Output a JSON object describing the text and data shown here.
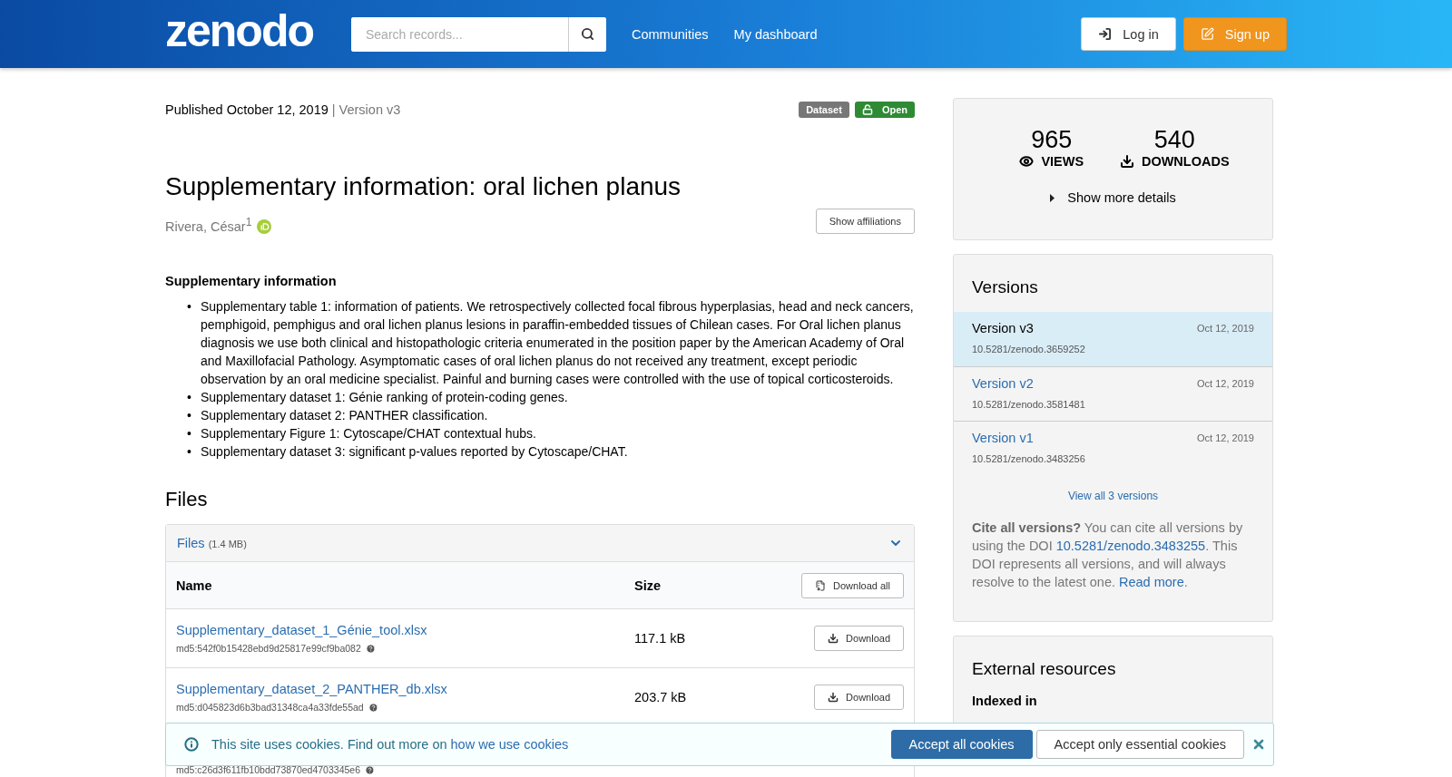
{
  "header": {
    "logo": "zenodo",
    "search": {
      "placeholder": "Search records..."
    },
    "nav": [
      {
        "label": "Communities"
      },
      {
        "label": "My dashboard"
      }
    ],
    "login": "Log in",
    "signup": "Sign up"
  },
  "record": {
    "published": "Published October 12, 2019",
    "version": "| Version v3",
    "badges": [
      {
        "label": "Dataset",
        "kind": "type"
      },
      {
        "label": "Open",
        "kind": "access"
      }
    ],
    "title": "Supplementary information: oral lichen planus",
    "authors": [
      {
        "name": "Rivera, César",
        "affiliation": "1",
        "orcid": true
      }
    ],
    "affiliations_button": "Show affiliations"
  },
  "description": {
    "heading": "Supplementary information",
    "marker": "•",
    "items": [
      "Supplementary table 1: information of patients. We retrospectively collected focal fibrous hyperplasias, head and neck cancers, pemphigoid, pemphigus and oral lichen planus lesions in paraffin-embedded tissues of Chilean cases. For Oral lichen planus diagnosis we use both clinical and histopathologic criteria enumerated in the position paper by the American Academy of Oral and Maxillofacial Pathology. Asymptomatic cases of oral lichen planus do not received any treatment, except periodic observation by an oral medicine specialist. Painful and burning cases were controlled with the use of topical corticosteroids.",
      "Supplementary dataset 1: Génie ranking of protein-coding genes.",
      "Supplementary dataset 2: PANTHER classification.",
      "Supplementary Figure 1: Cytoscape/CHAT contextual hubs.",
      "Supplementary dataset 3: significant p-values reported by Cytoscape/CHAT."
    ]
  },
  "files": {
    "heading": "Files",
    "panel_title": "Files",
    "panel_size": "(1.4 MB)",
    "expanded": true,
    "columns": [
      "Name",
      "Size"
    ],
    "download_all": "Download all",
    "rows": [
      {
        "name": "Supplementary_dataset_1_Génie_tool.xlsx",
        "md5": "md5:542f0b15428ebd9d25817e99cf9ba082",
        "size": "117.1 kB",
        "button": "Download"
      },
      {
        "name": "Supplementary_dataset_2_PANTHER_db.xlsx",
        "md5": "md5:d045823d6b3bad31348ca4a33fde55ad",
        "size": "203.7 kB",
        "button": "Download"
      },
      {
        "md5": "md5:c26d3f611fb10bdd73870ed4703345e6"
      }
    ]
  },
  "stats": {
    "views": "965",
    "views_label": "VIEWS",
    "downloads": "540",
    "downloads_label": "DOWNLOADS",
    "more": "Show more details"
  },
  "versions": {
    "title": "Versions",
    "items": [
      {
        "label": "Version v3",
        "date": "Oct 12, 2019",
        "doi": "10.5281/zenodo.3659252",
        "selected": true
      },
      {
        "label": "Version v2",
        "date": "Oct 12, 2019",
        "doi": "10.5281/zenodo.3581481",
        "selected": false
      },
      {
        "label": "Version v1",
        "date": "Oct 12, 2019",
        "doi": "10.5281/zenodo.3483256",
        "selected": false
      }
    ],
    "view_all": "View all 3 versions",
    "cite": {
      "bold": "Cite all versions?",
      "text1": " You can cite all versions by using the DOI ",
      "doi": "10.5281/zenodo.3483255",
      "text2": ". This DOI represents all versions, and will always resolve to the latest one. ",
      "link": "Read more",
      "text3": "."
    }
  },
  "external": {
    "title": "External resources",
    "indexed_in": "Indexed in"
  },
  "cookie": {
    "text": "This site uses cookies. Find out more on ",
    "link": "how we use cookies",
    "accept_all": "Accept all cookies",
    "essential": "Accept only essential cookies"
  }
}
